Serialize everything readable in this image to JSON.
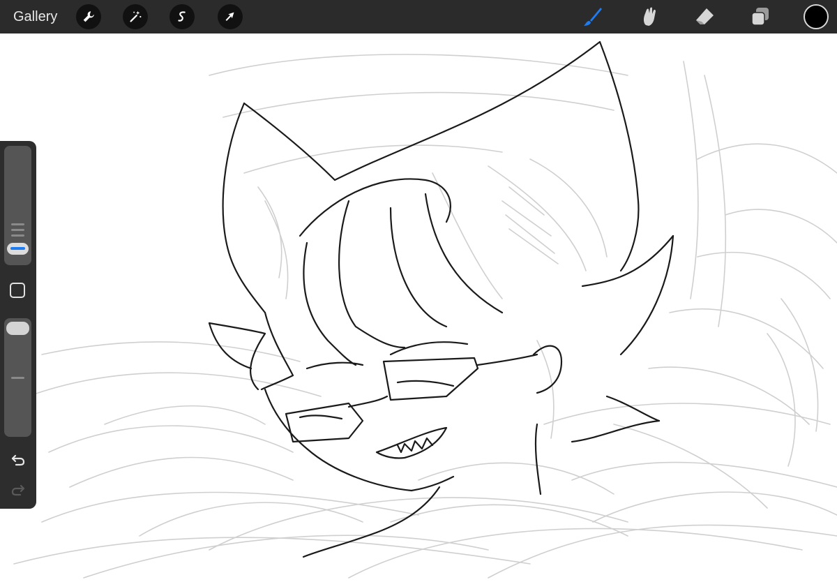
{
  "topbar": {
    "gallery_label": "Gallery",
    "left_tools": [
      "wrench-icon",
      "magic-wand-icon",
      "selection-icon",
      "transform-arrow-icon"
    ],
    "right_tools": [
      "brush-icon",
      "smudge-icon",
      "eraser-icon",
      "layers-icon"
    ],
    "active_tool": "brush-icon",
    "current_color": "#000000"
  },
  "colors": {
    "toolbar_bg": "#2b2b2b",
    "sidebar_bg": "#2d2d2d",
    "accent": "#1e7cf2",
    "canvas": "#ffffff",
    "sketch_gray": "#c8c8c8",
    "lineart": "#1a1a1a"
  },
  "sidebar": {
    "size_slider_value": 0.2,
    "opacity_slider_value": 1.0,
    "controls": [
      "size-slider",
      "modify-button",
      "opacity-slider",
      "undo-icon",
      "redo-icon"
    ],
    "redo_enabled": false
  }
}
